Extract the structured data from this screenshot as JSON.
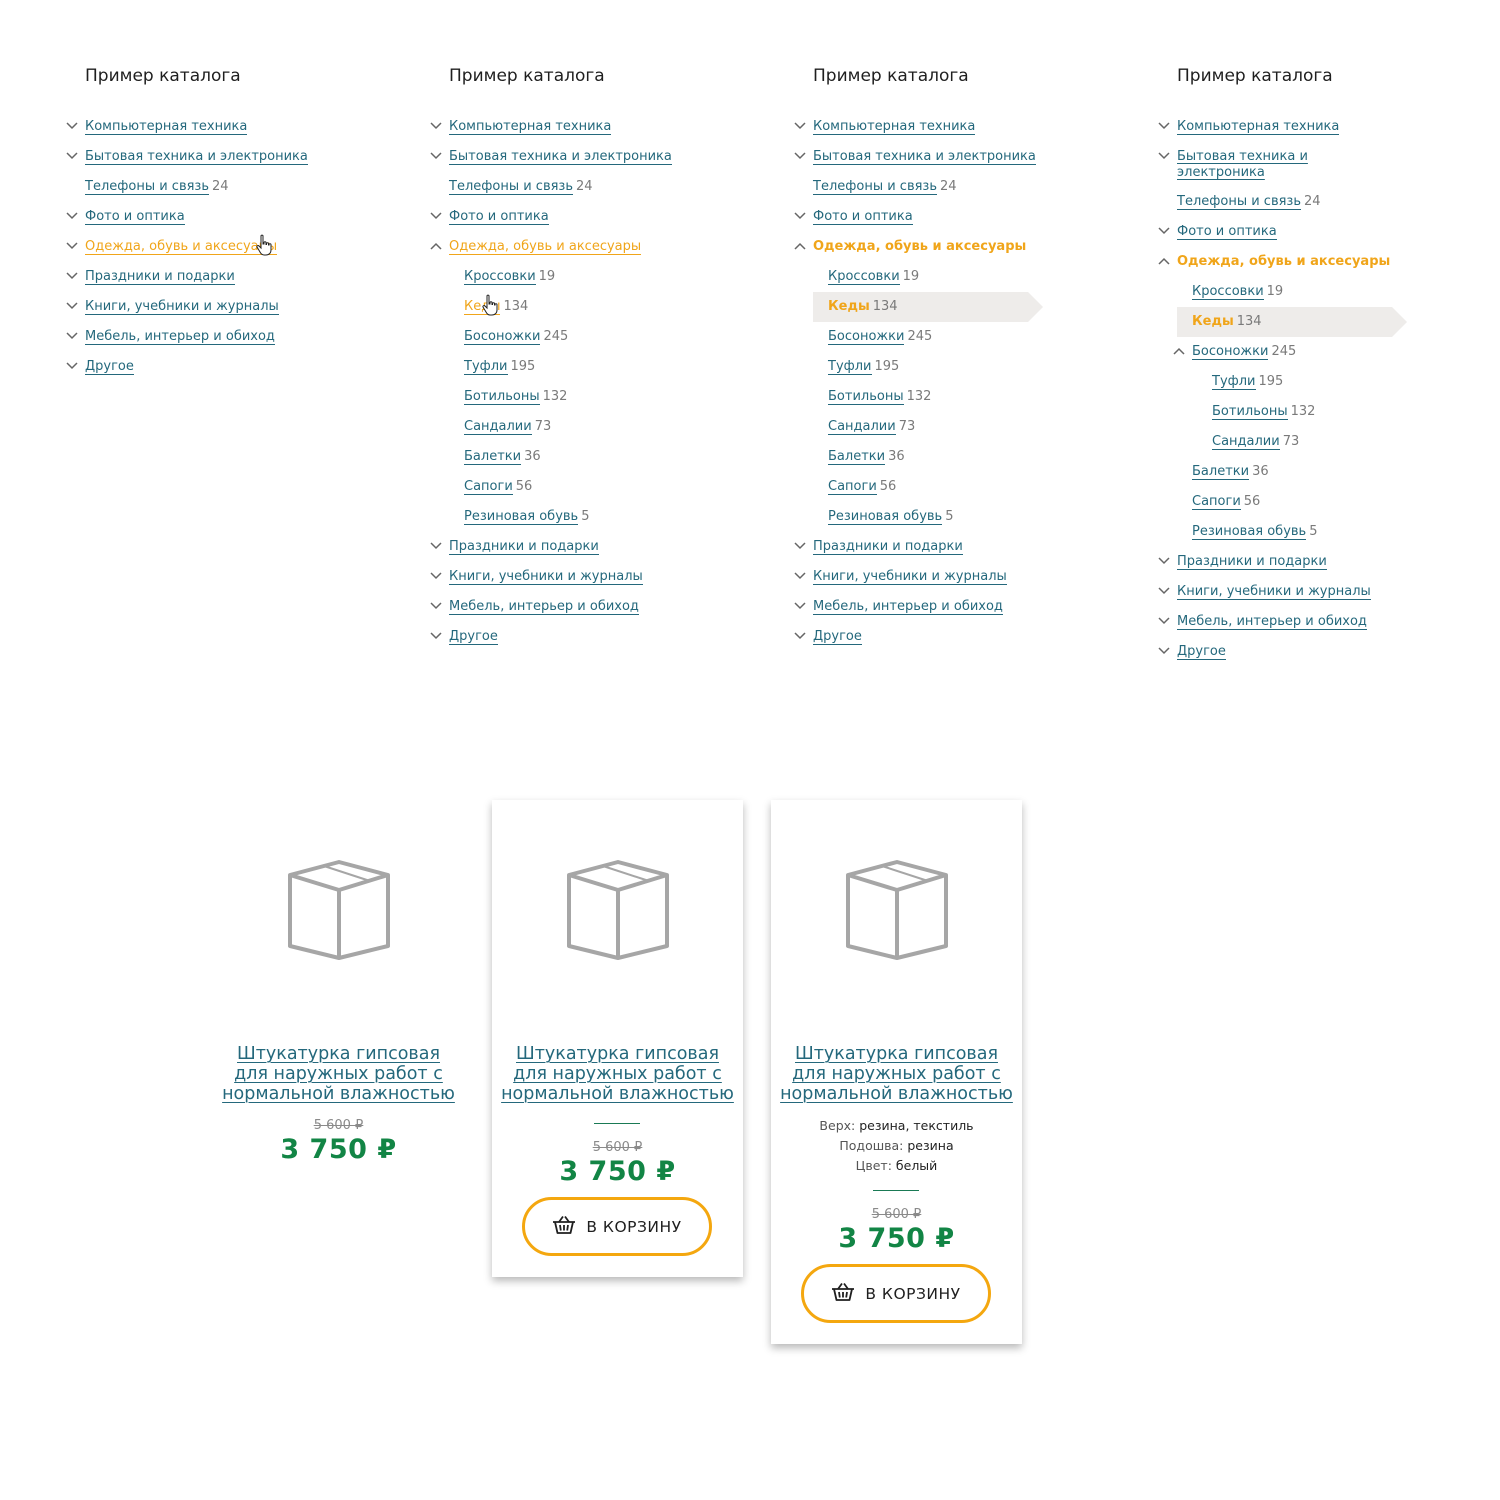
{
  "catalog_title": "Пример каталога",
  "categories": {
    "computers": "Компьютерная техника",
    "appliances": "Бытовая техника и электроника",
    "appliances_line1": "Бытовая техника и",
    "appliances_line2": "электроника",
    "phones": "Телефоны и связь",
    "phones_count": "24",
    "photo": "Фото и оптика",
    "clothing": "Одежда, обувь и аксесуары",
    "holidays": "Праздники и подарки",
    "books": "Книги, учебники и журналы",
    "furniture": "Мебель, интерьер и обиход",
    "other": "Другое"
  },
  "subcategories": {
    "sneakers": "Кроссовки",
    "sneakers_count": "19",
    "keds": "Кеды",
    "keds_count": "134",
    "sandals_b": "Босоножки",
    "sandals_b_count": "245",
    "shoes": "Туфли",
    "shoes_count": "195",
    "booties": "Ботильоны",
    "booties_count": "132",
    "sandals": "Сандалии",
    "sandals_count": "73",
    "flats": "Балетки",
    "flats_count": "36",
    "boots": "Сапоги",
    "boots_count": "56",
    "rubber": "Резиновая обувь",
    "rubber_count": "5"
  },
  "product": {
    "title_line1": "Штукатурка гипсовая",
    "title_line2": "для наружных работ с",
    "title_line3": "нормальной влажностью",
    "old_price": "5 600 ₽",
    "price": "3 750 ₽",
    "cart_label": "В КОРЗИНУ",
    "props": [
      {
        "label": "Верх:",
        "value": "резина, текстиль"
      },
      {
        "label": "Подошва:",
        "value": "резина"
      },
      {
        "label": "Цвет:",
        "value": "белый"
      }
    ]
  },
  "colors": {
    "link": "#24687c",
    "accent": "#f0a51a",
    "price": "#128545",
    "selected_bg": "#eeecea"
  },
  "icons": {
    "chevron": "chevron-down-icon",
    "chevron_open": "chevron-up-icon",
    "cursor": "hand-pointer-icon",
    "product": "box-icon",
    "basket": "basket-icon"
  }
}
